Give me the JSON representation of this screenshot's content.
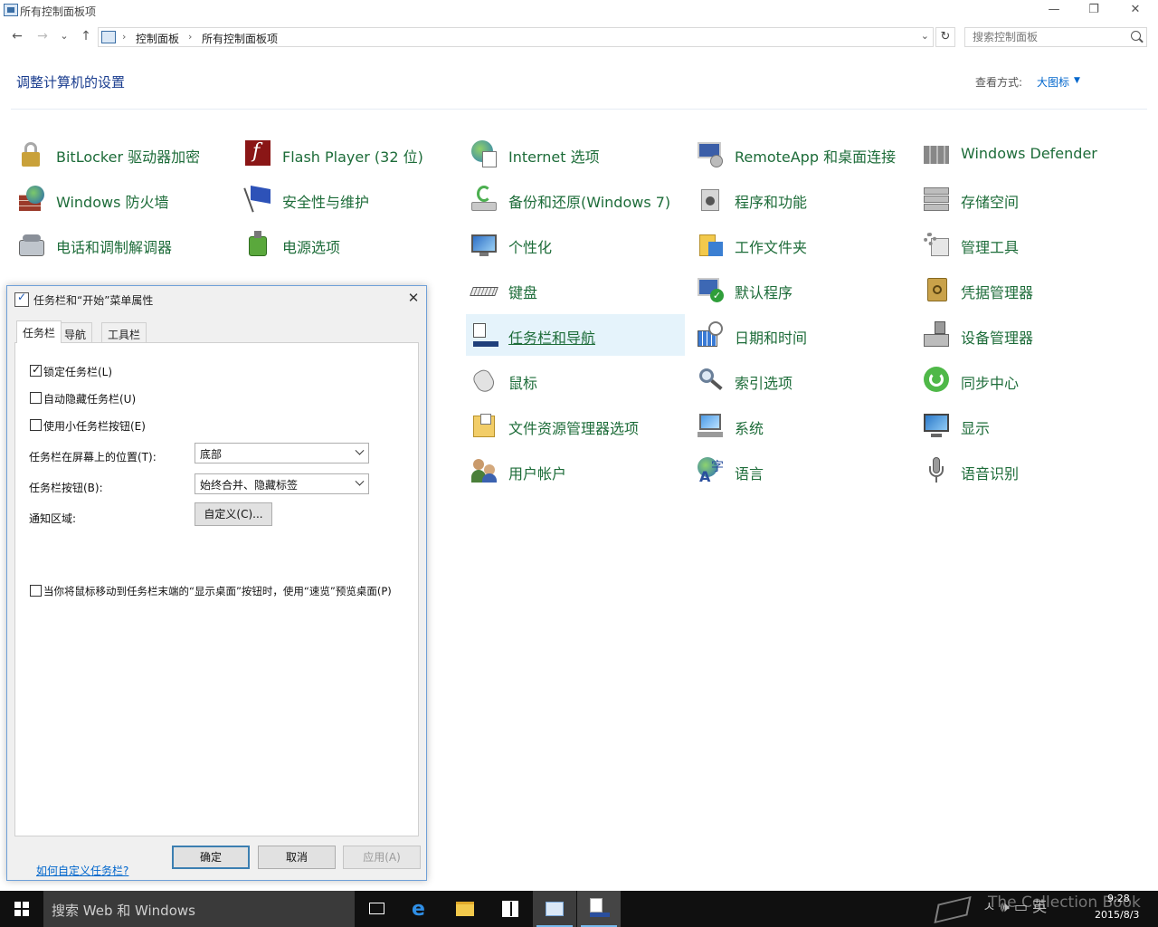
{
  "window": {
    "title": "所有控制面板项",
    "minimize": "—",
    "restore": "❐",
    "close": "✕"
  },
  "nav": {
    "back": "←",
    "forward": "→",
    "recent": "⌄",
    "up": "↑",
    "refresh": "↻",
    "breadcrumbs": [
      "控制面板",
      "所有控制面板项"
    ],
    "separator": "›",
    "address_dropdown": "⌄",
    "search_placeholder": "搜索控制面板"
  },
  "header": {
    "heading": "调整计算机的设置",
    "view_by_label": "查看方式:",
    "view_by_value": "大图标",
    "view_by_caret": "▼"
  },
  "items": [
    {
      "label": "BitLocker 驱动器加密",
      "icon": "bitlocker-icon"
    },
    {
      "label": "Flash Player (32 位)",
      "icon": "flash-icon"
    },
    {
      "label": "Internet 选项",
      "icon": "internet-options-icon"
    },
    {
      "label": "RemoteApp 和桌面连接",
      "icon": "remoteapp-icon"
    },
    {
      "label": "Windows Defender",
      "icon": "defender-icon"
    },
    {
      "label": "Windows 防火墙",
      "icon": "firewall-icon"
    },
    {
      "label": "安全性与维护",
      "icon": "security-flag-icon"
    },
    {
      "label": "备份和还原(Windows 7)",
      "icon": "backup-icon"
    },
    {
      "label": "程序和功能",
      "icon": "programs-icon"
    },
    {
      "label": "存储空间",
      "icon": "storage-icon"
    },
    {
      "label": "电话和调制解调器",
      "icon": "phone-modem-icon"
    },
    {
      "label": "电源选项",
      "icon": "power-icon"
    },
    {
      "label": "个性化",
      "icon": "personalize-icon"
    },
    {
      "label": "工作文件夹",
      "icon": "work-folders-icon"
    },
    {
      "label": "管理工具",
      "icon": "admin-tools-icon"
    },
    {
      "label": "键盘",
      "icon": "keyboard-icon"
    },
    {
      "label": "默认程序",
      "icon": "default-programs-icon"
    },
    {
      "label": "凭据管理器",
      "icon": "credential-icon"
    },
    {
      "label": "任务栏和导航",
      "icon": "taskbar-nav-icon"
    },
    {
      "label": "日期和时间",
      "icon": "datetime-icon"
    },
    {
      "label": "设备管理器",
      "icon": "device-manager-icon"
    },
    {
      "label": "鼠标",
      "icon": "mouse-icon"
    },
    {
      "label": "索引选项",
      "icon": "indexing-icon"
    },
    {
      "label": "同步中心",
      "icon": "sync-icon"
    },
    {
      "label": "文件资源管理器选项",
      "icon": "explorer-options-icon"
    },
    {
      "label": "系统",
      "icon": "system-icon"
    },
    {
      "label": "显示",
      "icon": "display-icon"
    },
    {
      "label": "用户帐户",
      "icon": "user-accounts-icon"
    },
    {
      "label": "语言",
      "icon": "language-icon"
    },
    {
      "label": "语音识别",
      "icon": "speech-icon"
    }
  ],
  "dialog": {
    "title": "任务栏和“开始”菜单属性",
    "close": "✕",
    "tabs": [
      "任务栏",
      "导航",
      "工具栏"
    ],
    "checkboxes": [
      {
        "label": "锁定任务栏(L)",
        "checked": true
      },
      {
        "label": "自动隐藏任务栏(U)",
        "checked": false
      },
      {
        "label": "使用小任务栏按钮(E)",
        "checked": false
      }
    ],
    "position_label": "任务栏在屏幕上的位置(T):",
    "position_value": "底部",
    "buttons_label": "任务栏按钮(B):",
    "buttons_value": "始终合并、隐藏标签",
    "notify_label": "通知区域:",
    "customize_button": "自定义(C)...",
    "peek_label": "当你将鼠标移动到任务栏末端的“显示桌面”按钮时，使用“速览”预览桌面(P)",
    "peek_checked": false,
    "help_link": "如何自定义任务栏?",
    "ok": "确定",
    "cancel": "取消",
    "apply": "应用(A)"
  },
  "taskbar": {
    "search_text": "搜索 Web 和 Windows",
    "tray": "ㅅ 🕪 ▭ 英",
    "watermark": "The Collection Book",
    "time": "9:28",
    "date": "2015/8/3"
  }
}
